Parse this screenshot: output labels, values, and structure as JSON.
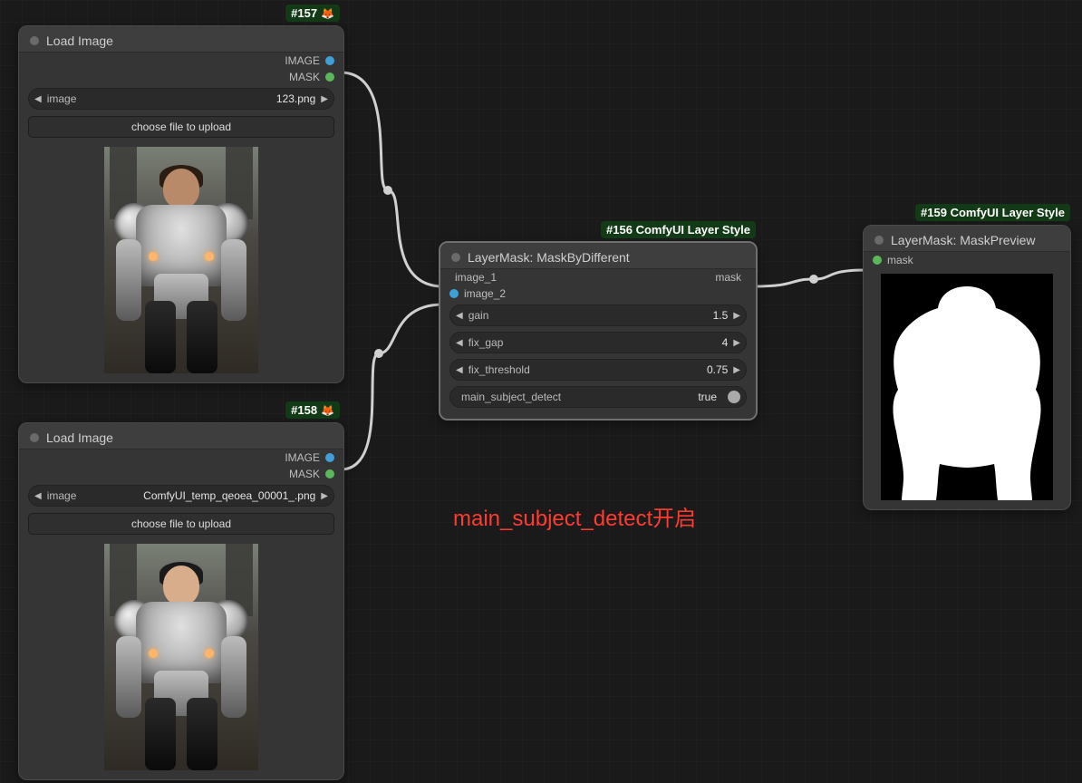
{
  "nodes": {
    "load1": {
      "badge": "#157",
      "title": "Load Image",
      "outputs": {
        "image": "IMAGE",
        "mask": "MASK"
      },
      "widget_image_label": "image",
      "widget_image_value": "123.png",
      "upload_btn": "choose file to upload"
    },
    "load2": {
      "badge": "#158",
      "title": "Load Image",
      "outputs": {
        "image": "IMAGE",
        "mask": "MASK"
      },
      "widget_image_label": "image",
      "widget_image_value": "ComfyUI_temp_qeoea_00001_.png",
      "upload_btn": "choose file to upload"
    },
    "layermask": {
      "badge": "#156 ComfyUI Layer Style",
      "title": "LayerMask: MaskByDifferent",
      "inputs": {
        "image1": "image_1",
        "image2": "image_2"
      },
      "outputs": {
        "mask": "mask"
      },
      "params": {
        "gain_label": "gain",
        "gain_value": "1.5",
        "fixgap_label": "fix_gap",
        "fixgap_value": "4",
        "fixthr_label": "fix_threshold",
        "fixthr_value": "0.75",
        "msd_label": "main_subject_detect",
        "msd_value": "true"
      }
    },
    "preview": {
      "badge": "#159 ComfyUI Layer Style",
      "title": "LayerMask: MaskPreview",
      "inputs": {
        "mask": "mask"
      }
    }
  },
  "annotation": "main_subject_detect开启"
}
